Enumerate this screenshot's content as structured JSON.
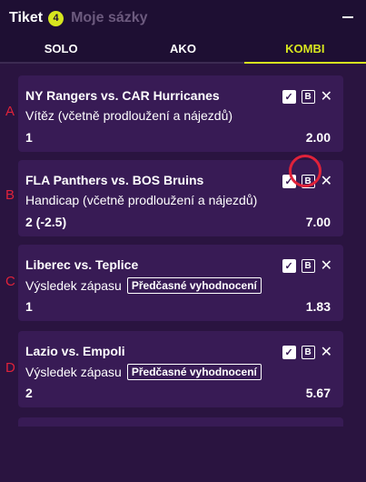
{
  "header": {
    "tab_ticket": "Tiket",
    "ticket_count": "4",
    "tab_my_bets": "Moje sázky"
  },
  "modes": [
    {
      "label": "SOLO",
      "active": false
    },
    {
      "label": "AKO",
      "active": false
    },
    {
      "label": "KOMBI",
      "active": true
    }
  ],
  "bets": [
    {
      "annotation": "A",
      "match": "NY Rangers vs. CAR Hurricanes",
      "market": "Vítěz (včetně prodloužení a nájezdů)",
      "badge": "",
      "pick": "1",
      "odds": "2.00"
    },
    {
      "annotation": "B",
      "match": "FLA Panthers vs. BOS Bruins",
      "market": "Handicap (včetně prodloužení a nájezdů)",
      "badge": "",
      "pick": "2 (-2.5)",
      "odds": "7.00"
    },
    {
      "annotation": "C",
      "match": "Liberec vs. Teplice",
      "market": "Výsledek zápasu",
      "badge": "Předčasné vyhodnocení",
      "pick": "1",
      "odds": "1.83"
    },
    {
      "annotation": "D",
      "match": "Lazio vs. Empoli",
      "market": "Výsledek zápasu",
      "badge": "Předčasné vyhodnocení",
      "pick": "2",
      "odds": "5.67"
    }
  ],
  "icons": {
    "check": "check-icon",
    "bank": "b-icon",
    "close": "close-icon"
  },
  "colors": {
    "accent": "#d7e51f",
    "annotation": "#e0223a",
    "card": "#381b55",
    "background": "#2a1440"
  }
}
